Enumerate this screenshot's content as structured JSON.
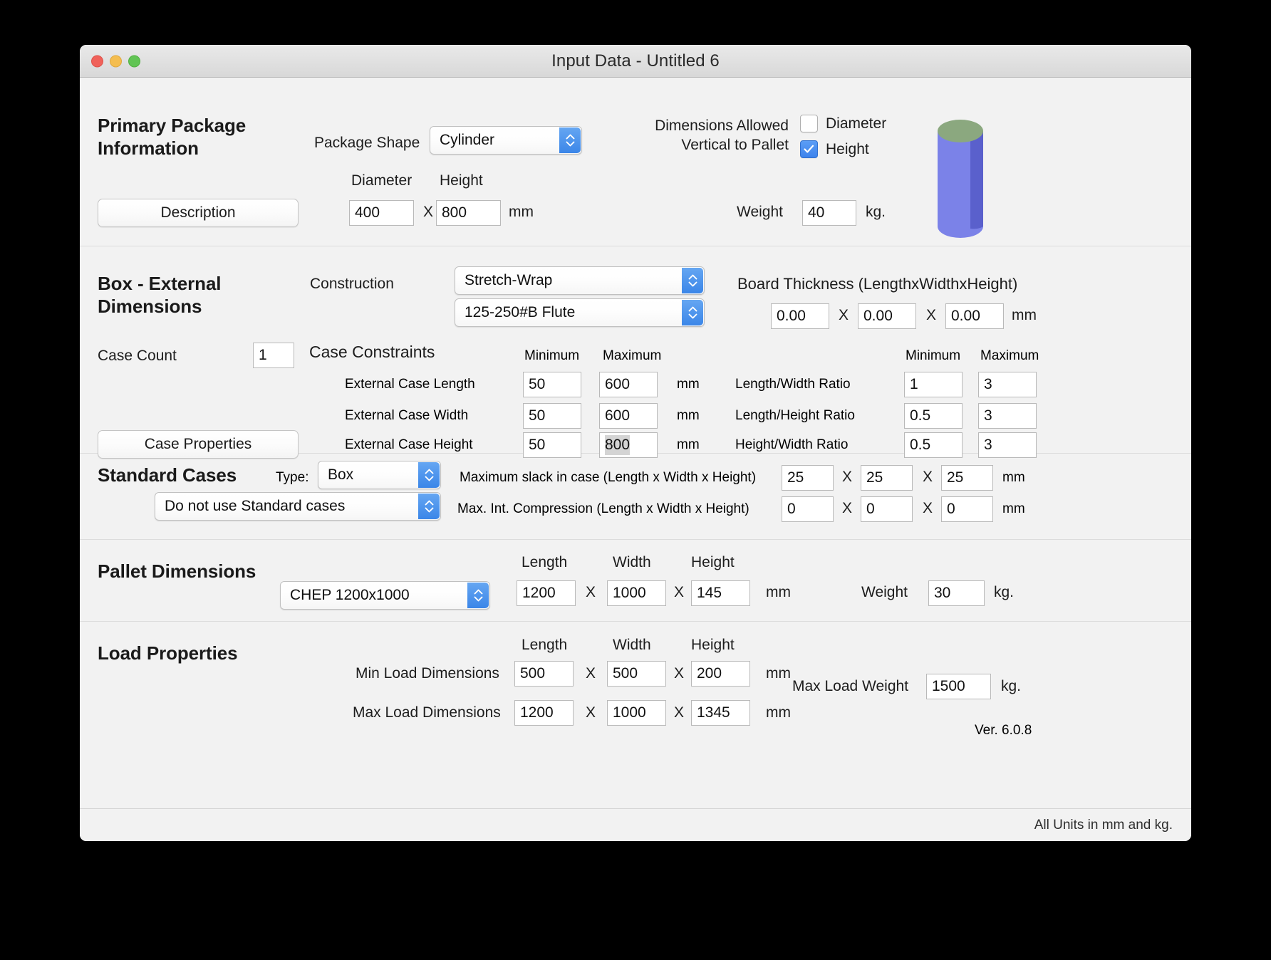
{
  "window": {
    "title": "Input Data - Untitled 6",
    "traffic_lights": [
      "close",
      "minimize",
      "zoom"
    ]
  },
  "primary_package": {
    "heading_line1": "Primary Package",
    "heading_line2": "Information",
    "description_button": "Description",
    "package_shape_label": "Package Shape",
    "package_shape_value": "Cylinder",
    "dim_label_1": "Diameter",
    "dim_label_2": "Height",
    "diameter_value": "400",
    "height_value": "800",
    "x_sep": "X",
    "unit_mm": "mm",
    "allowed_line1": "Dimensions Allowed",
    "allowed_line2": "Vertical to Pallet",
    "check_diameter_label": "Diameter",
    "check_diameter_checked": false,
    "check_height_label": "Height",
    "check_height_checked": true,
    "weight_label": "Weight",
    "weight_value": "40",
    "unit_kg": "kg.",
    "shape_preview": "cylinder",
    "shape_top_color": "#8ba87f",
    "shape_body_color": "#7b82e8",
    "shape_side_color": "#5a60cc"
  },
  "box_section": {
    "heading_line1": "Box - External",
    "heading_line2": "Dimensions",
    "construction_label": "Construction",
    "construction_value": "Stretch-Wrap",
    "flute_value": "125-250#B Flute",
    "board_thickness_label": "Board Thickness (LengthxWidthxHeight)",
    "board_thickness": [
      "0.00",
      "0.00",
      "0.00"
    ],
    "board_unit": "mm",
    "case_count_label": "Case Count",
    "case_count_value": "1",
    "case_properties_button": "Case Properties",
    "case_constraints_label": "Case Constraints",
    "col_min": "Minimum",
    "col_max": "Maximum",
    "unit_mm": "mm",
    "x_sep": "X",
    "constraints": [
      {
        "label": "External Case Length",
        "min": "50",
        "max": "600",
        "unit": "mm",
        "max_selected": false
      },
      {
        "label": "External Case Width",
        "min": "50",
        "max": "600",
        "unit": "mm",
        "max_selected": false
      },
      {
        "label": "External Case Height",
        "min": "50",
        "max": "800",
        "unit": "mm",
        "max_selected": true
      }
    ],
    "ratio_col_min": "Minimum",
    "ratio_col_max": "Maximum",
    "ratios": [
      {
        "label": "Length/Width Ratio",
        "min": "1",
        "max": "3"
      },
      {
        "label": "Length/Height Ratio",
        "min": "0.5",
        "max": "3"
      },
      {
        "label": "Height/Width Ratio",
        "min": "0.5",
        "max": "3"
      }
    ]
  },
  "standard_cases": {
    "heading": "Standard Cases",
    "type_label": "Type:",
    "type_value": "Box",
    "usage_value": "Do not use Standard cases",
    "slack_label": "Maximum slack in case  (Length x Width x Height)",
    "slack_values": [
      "25",
      "25",
      "25"
    ],
    "slack_unit": "mm",
    "compression_label": "Max. Int. Compression (Length x Width x Height)",
    "compression_values": [
      "0",
      "0",
      "0"
    ],
    "compression_unit": "mm",
    "x_sep": "X"
  },
  "pallet": {
    "heading": "Pallet Dimensions",
    "pallet_value": "CHEP 1200x1000",
    "col_length": "Length",
    "col_width": "Width",
    "col_height": "Height",
    "length": "1200",
    "width": "1000",
    "height": "145",
    "unit_mm": "mm",
    "x_sep": "X",
    "weight_label": "Weight",
    "weight_value": "30",
    "unit_kg": "kg."
  },
  "load": {
    "heading": "Load Properties",
    "col_length": "Length",
    "col_width": "Width",
    "col_height": "Height",
    "min_label": "Min Load Dimensions",
    "min_values": [
      "500",
      "500",
      "200"
    ],
    "min_unit": "mm",
    "max_label": "Max Load Dimensions",
    "max_values": [
      "1200",
      "1000",
      "1345"
    ],
    "max_unit": "mm",
    "x_sep": "X",
    "max_weight_label": "Max Load Weight",
    "max_weight_value": "1500",
    "unit_kg": "kg.",
    "version": "Ver. 6.0.8"
  },
  "footer": {
    "units_note": "All Units in mm and kg."
  }
}
